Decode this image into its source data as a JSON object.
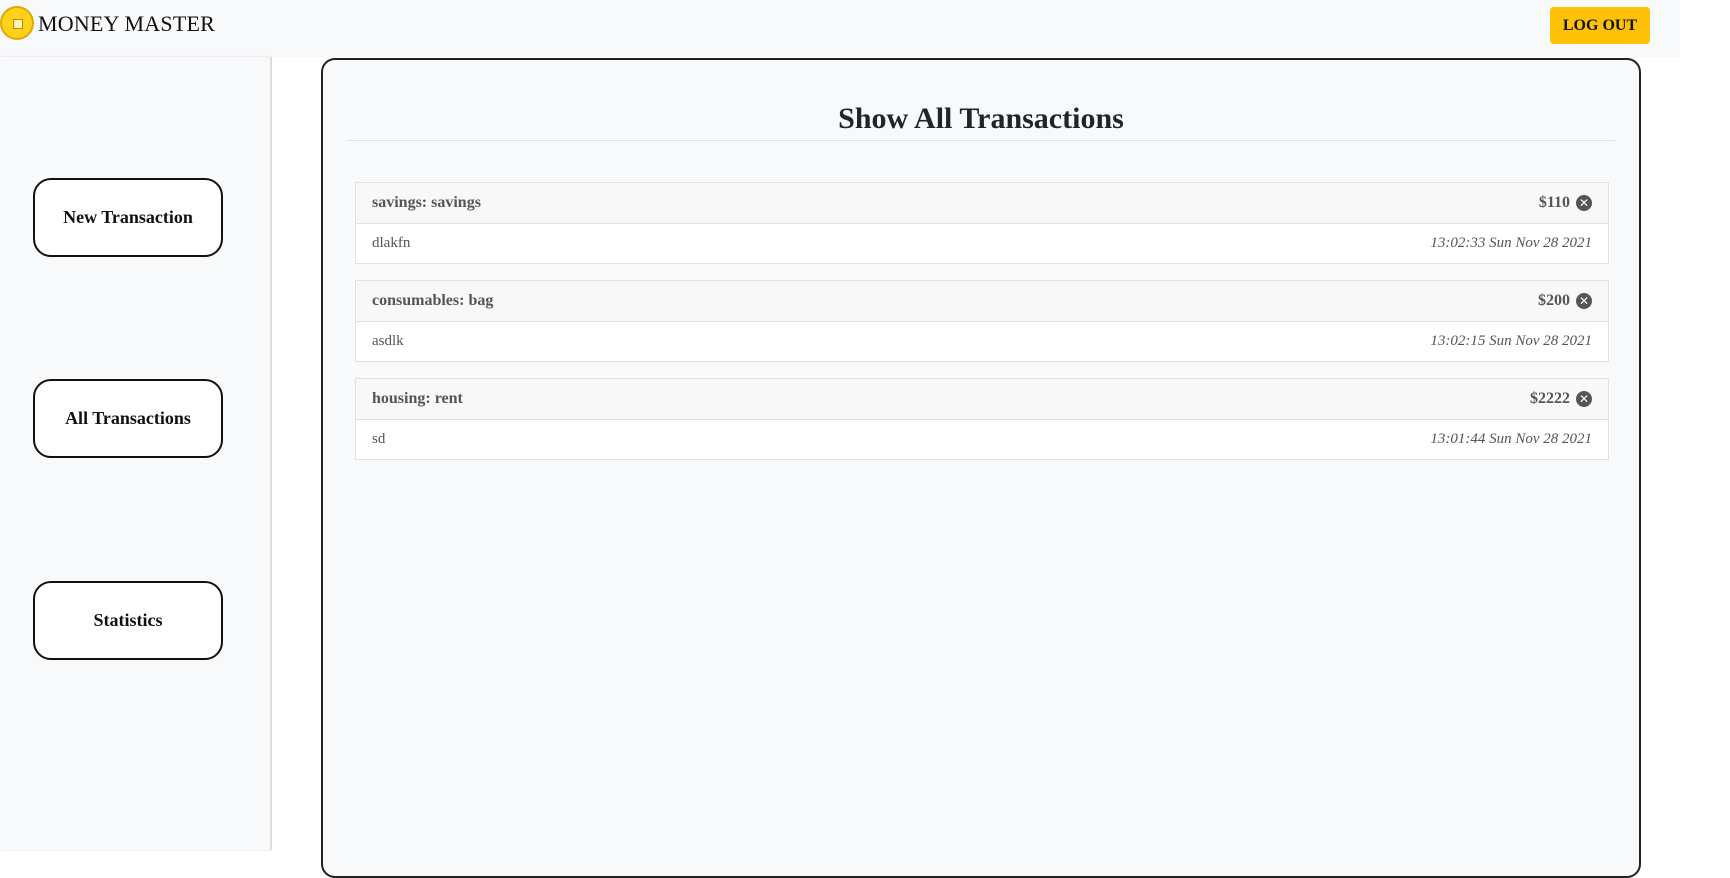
{
  "header": {
    "brand": "MONEY MASTER",
    "logout_label": "LOG OUT"
  },
  "sidebar": {
    "items": [
      {
        "label": "New Transaction"
      },
      {
        "label": "All Transactions"
      },
      {
        "label": "Statistics"
      }
    ]
  },
  "main": {
    "title": "Show All Transactions",
    "transactions": [
      {
        "category": "savings: savings",
        "amount": "$110",
        "note": "dlakfn",
        "datetime": "13:02:33 Sun Nov 28 2021"
      },
      {
        "category": "consumables: bag",
        "amount": "$200",
        "note": "asdlk",
        "datetime": "13:02:15 Sun Nov 28 2021"
      },
      {
        "category": "housing: rent",
        "amount": "$2222",
        "note": "sd",
        "datetime": "13:01:44 Sun Nov 28 2021"
      }
    ]
  },
  "icons": {
    "logo": "coin-logo-icon",
    "delete": "close-circle-icon"
  },
  "colors": {
    "accent": "#ffc107",
    "background": "#f8f9fa",
    "text_muted": "#555555"
  }
}
